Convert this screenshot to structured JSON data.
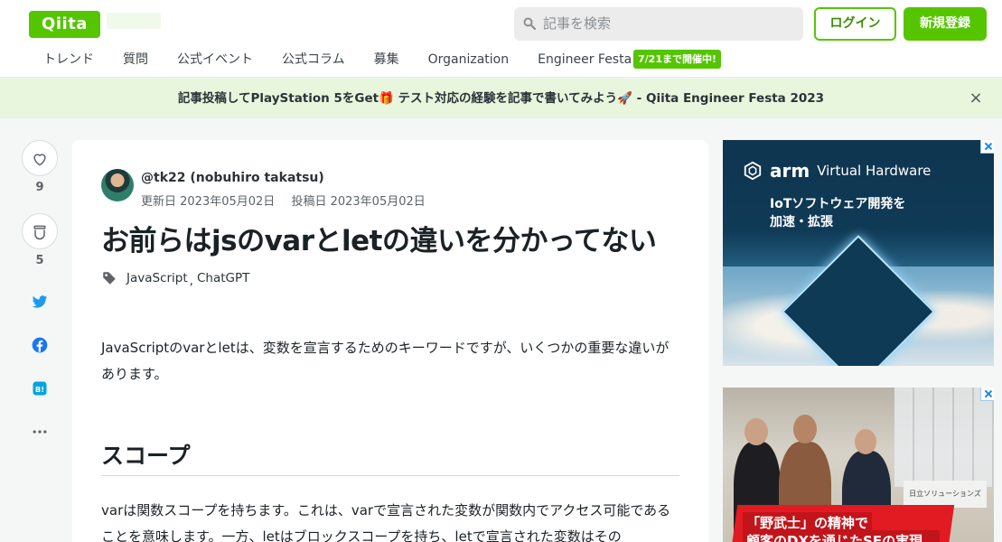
{
  "header": {
    "logo": "Qiita",
    "search_placeholder": "記事を検索",
    "login_label": "ログイン",
    "signup_label": "新規登録"
  },
  "nav": {
    "items": [
      "トレンド",
      "質問",
      "公式イベント",
      "公式コラム",
      "募集",
      "Organization",
      "Engineer Festa"
    ],
    "badge": "7/21まで開催中!"
  },
  "banner": {
    "text": "記事投稿してPlayStation 5をGet🎁 テスト対応の経験を記事で書いてみよう🚀 - Qiita Engineer Festa 2023",
    "close": "×"
  },
  "sidebar": {
    "like_count": "9",
    "stock_count": "5"
  },
  "article": {
    "author": "@tk22 (nobuhiro takatsu)",
    "updated": "更新日 2023年05月02日",
    "posted": "投稿日 2023年05月02日",
    "title": "お前らはjsのvarとletの違いを分かってない",
    "tags": [
      "JavaScript",
      "ChatGPT"
    ],
    "tag_separator": ",",
    "paragraph1": "JavaScriptのvarとletは、変数を宣言するためのキーワードですが、いくつかの重要な違いがあります。",
    "heading": "スコープ",
    "paragraph2": "varは関数スコープを持ちます。これは、varで宣言された変数が関数内でアクセス可能であることを意味します。一方、letはブロックスコープを持ち、letで宣言された変数はその"
  },
  "ads": {
    "ad1_brand": "arm",
    "ad1_brand_sub": "Virtual Hardware",
    "ad1_line1": "IoTソフトウェア開発を",
    "ad1_line2": "加速・拡張",
    "ad2_sign": "日立ソリューションズ",
    "ad2_line1": "「野武士」の精神で",
    "ad2_line2": "顧客のDXを通じたSEの実現。"
  },
  "colors": {
    "brand": "#55c500",
    "banner_bg": "#e7f6dd",
    "twitter": "#1d9bf0",
    "facebook": "#1877f2",
    "hatena": "#00a4de"
  }
}
